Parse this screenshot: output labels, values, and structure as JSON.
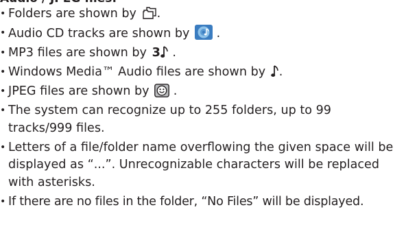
{
  "heading": "Audio / JPEG files:",
  "items": [
    {
      "text": "Folders are shown by",
      "icon": "folder-stack-icon",
      "after": "."
    },
    {
      "text": "Audio CD tracks are shown by",
      "icon": "audio-cd-icon",
      "after": " ."
    },
    {
      "text": "MP3 files are shown by",
      "icon": "mp3-note-icon",
      "icon_text": "3",
      "after": " ."
    },
    {
      "text": "Windows Media™ Audio files are shown by",
      "icon": "music-note-icon",
      "after": "."
    },
    {
      "text": "JPEG files are shown by",
      "icon": "jpeg-smiley-icon",
      "after": " ."
    },
    {
      "text": "The system can recognize up to 255 folders, up to 99 tracks/999 files."
    },
    {
      "text": "Letters of a file/folder name overflowing the given space will be displayed as “...”. Unrecognizable characters will be replaced with asterisks."
    },
    {
      "text": "If there are no files in the folder, “No Files” will be displayed."
    }
  ],
  "bullet": "•",
  "colors": {
    "text": "#231f20",
    "cd_blue": "#3a7cc0",
    "cd_light": "#8fc3ea"
  }
}
